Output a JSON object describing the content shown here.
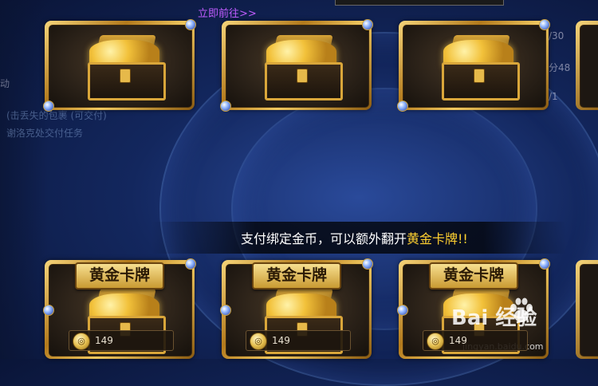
{
  "link": {
    "label": "立即前往>>"
  },
  "background": {
    "lines": [
      "(击丢失的包裹 (可交付)",
      "谢洛克处交付任务"
    ],
    "side_button": "动",
    "edge_numbers": [
      "/30",
      "分48",
      "/1"
    ]
  },
  "top_row": {
    "cards": [
      {
        "icon": "treasure-chest-icon"
      },
      {
        "icon": "treasure-chest-icon"
      },
      {
        "icon": "treasure-chest-icon"
      }
    ]
  },
  "banner": {
    "text_before": "支付绑定金币，可以额外翻开",
    "text_highlight": "黄金卡牌!!"
  },
  "bottom_row": {
    "cards": [
      {
        "title": "黄金卡牌",
        "price": "149",
        "icon": "gold-coin-icon"
      },
      {
        "title": "黄金卡牌",
        "price": "149",
        "icon": "gold-coin-icon"
      },
      {
        "title": "黄金卡牌",
        "price": "149",
        "icon": "gold-coin-icon"
      }
    ]
  },
  "watermark": {
    "brand": "Bai  经验",
    "url": "jingyan.baidu.com"
  },
  "colors": {
    "link": "#c05cff",
    "highlight": "#ffd030",
    "frame_gold": "#d9a63a"
  }
}
